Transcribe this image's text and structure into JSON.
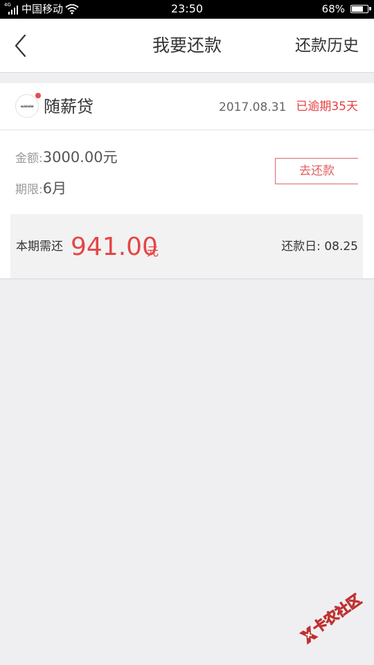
{
  "status_bar": {
    "network": "4G",
    "carrier": "中国移动",
    "time": "23:50",
    "battery": "68%",
    "battery_level": 0.68
  },
  "nav": {
    "title": "我要还款",
    "history_label": "还款历史"
  },
  "loan": {
    "logo_text": "suixindai",
    "product_name": "随薪贷",
    "date": "2017.08.31",
    "overdue": "已逾期35天",
    "amount_label": "金额:",
    "amount_value": "3000.00元",
    "term_label": "期限:",
    "term_value": "6月",
    "repay_button": "去还款",
    "due_label": "本期需还",
    "due_amount": "941.00",
    "due_unit": "元",
    "due_date": "还款日: 08.25"
  },
  "watermark": {
    "text": "卡农社区",
    "color": "#c03030"
  },
  "colors": {
    "accent_red": "#e64545",
    "background": "#efeff1"
  }
}
